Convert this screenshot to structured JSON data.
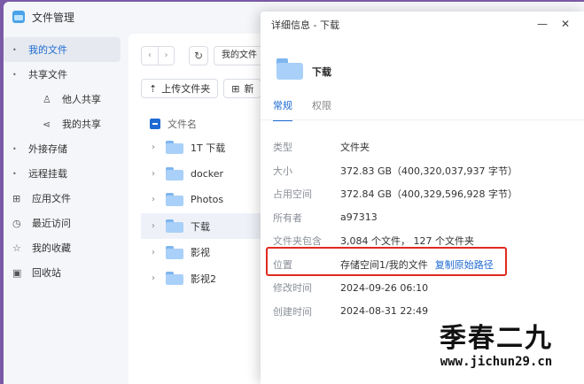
{
  "app": {
    "title": "文件管理"
  },
  "sidebar": {
    "items": [
      {
        "label": "我的文件",
        "icon": "caret-right",
        "active": true
      },
      {
        "label": "共享文件",
        "icon": "caret-down"
      },
      {
        "label": "他人共享",
        "icon": "user-icon",
        "sub": true
      },
      {
        "label": "我的共享",
        "icon": "share-icon",
        "sub": true
      },
      {
        "label": "外接存储",
        "icon": "caret-right"
      },
      {
        "label": "远程挂载",
        "icon": "caret-right"
      },
      {
        "label": "应用文件",
        "icon": "apps-icon"
      },
      {
        "label": "最近访问",
        "icon": "clock-icon"
      },
      {
        "label": "我的收藏",
        "icon": "star-icon"
      },
      {
        "label": "回收站",
        "icon": "trash-icon"
      }
    ]
  },
  "toolbar": {
    "path": "我的文件",
    "upload_label": "上传文件夹",
    "new_label": "新"
  },
  "list": {
    "header": "文件名",
    "rows": [
      {
        "name": "1T 下载"
      },
      {
        "name": "docker"
      },
      {
        "name": "Photos"
      },
      {
        "name": "下载",
        "selected": true
      },
      {
        "name": "影视"
      },
      {
        "name": "影视2"
      }
    ]
  },
  "dialog": {
    "title": "详细信息 - 下载",
    "name": "下载",
    "tabs": [
      "常规",
      "权限"
    ],
    "props": [
      {
        "k": "类型",
        "v": "文件夹"
      },
      {
        "k": "大小",
        "v": "372.83 GB（400,320,037,937 字节）"
      },
      {
        "k": "占用空间",
        "v": "372.84 GB（400,329,596,928 字节）"
      },
      {
        "k": "所有者",
        "v": "a97313"
      },
      {
        "k": "文件夹包含",
        "v": "3,084 个文件， 127 个文件夹"
      },
      {
        "k": "位置",
        "v": "存储空间1/我的文件",
        "link": "复制原始路径"
      },
      {
        "k": "修改时间",
        "v": "2024-09-26 06:10"
      },
      {
        "k": "创建时间",
        "v": "2024-08-31 22:49"
      }
    ]
  },
  "watermark": {
    "big": "季春二九",
    "small": "www.jichun29.cn"
  },
  "colors": {
    "accent": "#1e6ad3",
    "highlight": "#e02a1f",
    "folder": "#a9d0f8"
  }
}
